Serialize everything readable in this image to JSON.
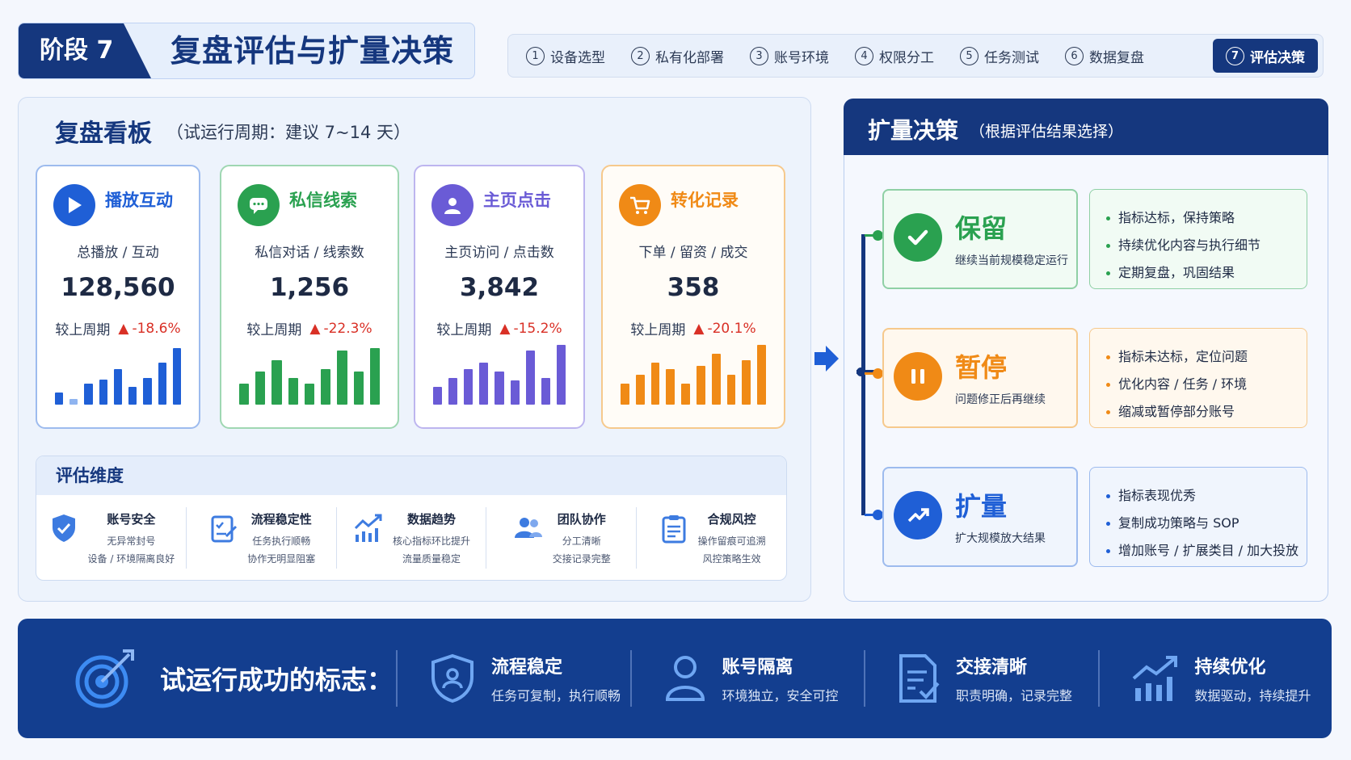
{
  "header": {
    "stage_label": "阶段 7",
    "stage_title": "复盘评估与扩量决策",
    "steps": [
      {
        "num": "1",
        "label": "设备选型"
      },
      {
        "num": "2",
        "label": "私有化部署"
      },
      {
        "num": "3",
        "label": "账号环境"
      },
      {
        "num": "4",
        "label": "权限分工"
      },
      {
        "num": "5",
        "label": "任务测试"
      },
      {
        "num": "6",
        "label": "数据复盘"
      },
      {
        "num": "7",
        "label": "评估决策",
        "active": true
      }
    ]
  },
  "board": {
    "title": "复盘看板",
    "subtitle": "（试运行周期：建议 7~14 天）",
    "compare_label": "较上周期",
    "cards": [
      {
        "title": "播放互动",
        "label": "总播放 / 互动",
        "value": "128,560",
        "change": "-18.6%",
        "color": "#1f5fd6",
        "icon": "play-icon",
        "bars": [
          0.2,
          0.1,
          0.35,
          0.42,
          0.6,
          0.3,
          0.45,
          0.7,
          0.95
        ],
        "bar_colors": [
          "#1f5fd6",
          "#8fb4f0",
          "#1f5fd6",
          "#1f5fd6",
          "#1f5fd6",
          "#1f5fd6",
          "#1f5fd6",
          "#1f5fd6",
          "#1f5fd6"
        ]
      },
      {
        "title": "私信线索",
        "label": "私信对话 / 线索数",
        "value": "1,256",
        "change": "-22.3%",
        "color": "#2aa150",
        "icon": "message-icon",
        "bars": [
          0.35,
          0.55,
          0.75,
          0.45,
          0.35,
          0.6,
          0.9,
          0.55,
          0.95
        ],
        "bar_colors": [
          "#2aa150"
        ]
      },
      {
        "title": "主页点击",
        "label": "主页访问 / 点击数",
        "value": "3,842",
        "change": "-15.2%",
        "color": "#6a5bd6",
        "icon": "user-icon",
        "bars": [
          0.3,
          0.45,
          0.6,
          0.7,
          0.55,
          0.4,
          0.9,
          0.45,
          1.0
        ],
        "bar_colors": [
          "#6a5bd6"
        ]
      },
      {
        "title": "转化记录",
        "label": "下单 / 留资 / 成交",
        "value": "358",
        "change": "-20.1%",
        "color": "#f08a16",
        "icon": "cart-icon",
        "bars": [
          0.35,
          0.5,
          0.7,
          0.6,
          0.35,
          0.65,
          0.85,
          0.5,
          0.75,
          1.0
        ],
        "bar_colors": [
          "#f08a16"
        ]
      }
    ]
  },
  "evaluation": {
    "title": "评估维度",
    "items": [
      {
        "title": "账号安全",
        "lines": [
          "无异常封号",
          "设备 / 环境隔离良好"
        ],
        "icon": "shield-icon"
      },
      {
        "title": "流程稳定性",
        "lines": [
          "任务执行顺畅",
          "协作无明显阻塞"
        ],
        "icon": "checklist-icon"
      },
      {
        "title": "数据趋势",
        "lines": [
          "核心指标环比提升",
          "流量质量稳定"
        ],
        "icon": "trend-chart-icon"
      },
      {
        "title": "团队协作",
        "lines": [
          "分工清晰",
          "交接记录完整"
        ],
        "icon": "team-icon"
      },
      {
        "title": "合规风控",
        "lines": [
          "操作留痕可追溯",
          "风控策略生效"
        ],
        "icon": "clipboard-icon"
      }
    ]
  },
  "decision": {
    "title": "扩量决策",
    "subtitle": "（根据评估结果选择）",
    "options": [
      {
        "title": "保留",
        "desc": "继续当前规模稳定运行",
        "color": "#2aa150",
        "border": "#8fd0a5",
        "bg": "#f1fbf4",
        "icon": "check-icon",
        "bullets": [
          "指标达标，保持策略",
          "持续优化内容与执行细节",
          "定期复盘，巩固结果"
        ]
      },
      {
        "title": "暂停",
        "desc": "问题修正后再继续",
        "color": "#f08a16",
        "border": "#f6c98c",
        "bg": "#fff8ee",
        "icon": "pause-icon",
        "bullets": [
          "指标未达标，定位问题",
          "优化内容 / 任务 / 环境",
          "缩减或暂停部分账号"
        ]
      },
      {
        "title": "扩量",
        "desc": "扩大规模放大结果",
        "color": "#1f5fd6",
        "border": "#9dbbee",
        "bg": "#f0f5fd",
        "icon": "growth-icon",
        "bullets": [
          "指标表现优秀",
          "复制成功策略与 SOP",
          "增加账号 / 扩展类目 / 加大投放"
        ]
      }
    ]
  },
  "footer": {
    "title": "试运行成功的标志：",
    "items": [
      {
        "title": "流程稳定",
        "desc": "任务可复制，执行顺畅",
        "icon": "shield-user-icon"
      },
      {
        "title": "账号隔离",
        "desc": "环境独立，安全可控",
        "icon": "person-icon"
      },
      {
        "title": "交接清晰",
        "desc": "职责明确，记录完整",
        "icon": "document-check-icon"
      },
      {
        "title": "持续优化",
        "desc": "数据驱动，持续提升",
        "icon": "bar-trend-icon"
      }
    ]
  }
}
